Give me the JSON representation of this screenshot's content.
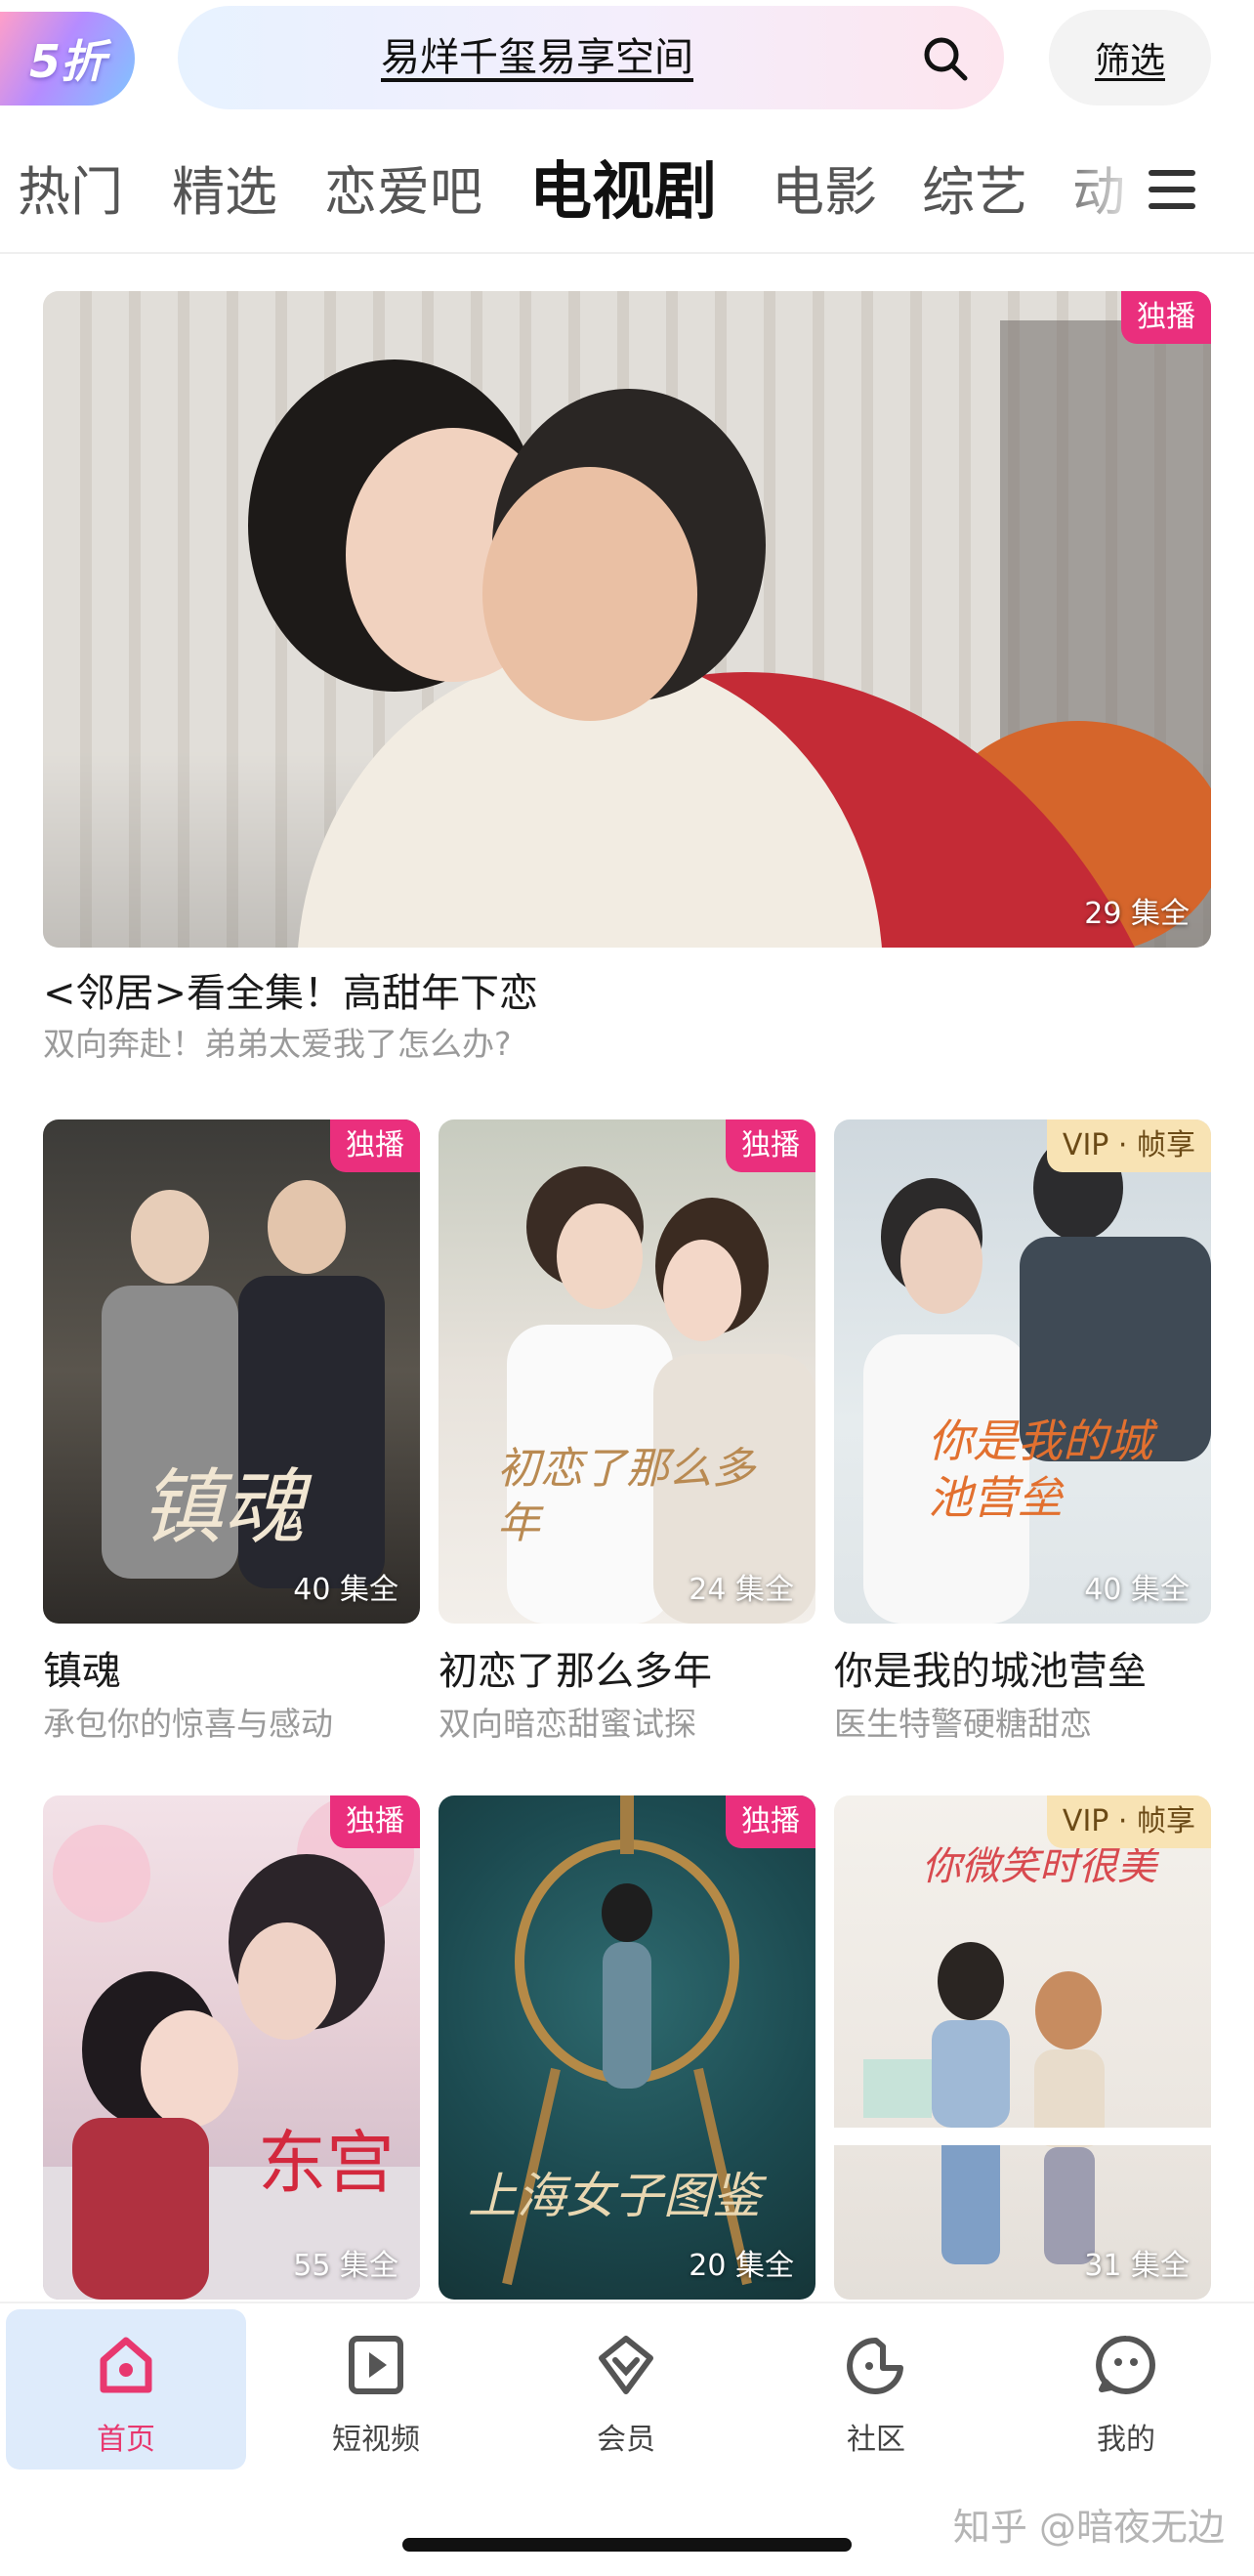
{
  "header": {
    "logo_text": "5折",
    "search_text": "易烊千玺易享空间",
    "filter_label": "筛选"
  },
  "tabs": [
    {
      "label": "热门",
      "active": false
    },
    {
      "label": "精选",
      "active": false
    },
    {
      "label": "恋爱吧",
      "active": false
    },
    {
      "label": "电视剧",
      "active": true
    },
    {
      "label": "电影",
      "active": false
    },
    {
      "label": "综艺",
      "active": false
    },
    {
      "label": "动",
      "active": false
    }
  ],
  "featured": {
    "badge": "独播",
    "episodes": "29 集全",
    "title": "<邻居>看全集！高甜年下恋",
    "subtitle": "双向奔赴！弟弟太爱我了怎么办?"
  },
  "shows": [
    {
      "badge": "独播",
      "badge_type": "exclusive",
      "episodes": "40 集全",
      "title": "镇魂",
      "subtitle": "承包你的惊喜与感动",
      "poster_text": "镇魂"
    },
    {
      "badge": "独播",
      "badge_type": "exclusive",
      "episodes": "24 集全",
      "title": "初恋了那么多年",
      "subtitle": "双向暗恋甜蜜试探",
      "poster_text": "初恋了那么多年"
    },
    {
      "badge": "VIP · 帧享",
      "badge_type": "vip",
      "episodes": "40 集全",
      "title": "你是我的城池营垒",
      "subtitle": "医生特警硬糖甜恋",
      "poster_text": "你是我的城池营垒"
    },
    {
      "badge": "独播",
      "badge_type": "exclusive",
      "episodes": "55 集全",
      "title": "",
      "subtitle": "",
      "poster_text": "东宫"
    },
    {
      "badge": "独播",
      "badge_type": "exclusive",
      "episodes": "20 集全",
      "title": "",
      "subtitle": "",
      "poster_text": "上海女子图鉴"
    },
    {
      "badge": "VIP · 帧享",
      "badge_type": "vip",
      "episodes": "31 集全",
      "title": "",
      "subtitle": "",
      "poster_text": "你微笑时很美"
    }
  ],
  "bottom_nav": [
    {
      "label": "首页",
      "icon": "home-icon",
      "active": true
    },
    {
      "label": "短视频",
      "icon": "play-icon",
      "active": false
    },
    {
      "label": "会员",
      "icon": "vip-diamond-icon",
      "active": false
    },
    {
      "label": "社区",
      "icon": "community-icon",
      "active": false
    },
    {
      "label": "我的",
      "icon": "profile-icon",
      "active": false
    }
  ],
  "watermark": "知乎 @暗夜无边",
  "colors": {
    "accent_pink": "#ea2f7d",
    "vip_gold": "#f8e3b4",
    "nav_active_bg": "#deebfb"
  }
}
